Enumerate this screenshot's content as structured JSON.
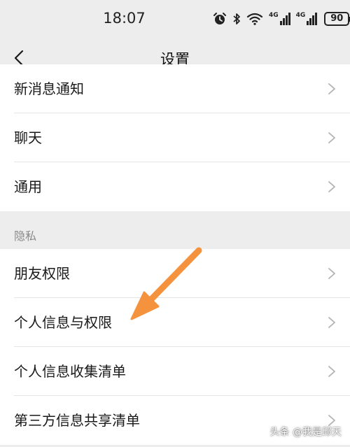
{
  "status_bar": {
    "time": "18:07",
    "icons": [
      "alarm-icon",
      "bluetooth-icon",
      "wifi-icon",
      "signal-4g-icon",
      "signal-4g-icon"
    ],
    "signal_label_1": "4G",
    "signal_label_2": "4G",
    "battery": "90"
  },
  "nav": {
    "title": "设置",
    "back_icon": "chevron-left-icon"
  },
  "groups": [
    {
      "items": [
        {
          "label": "新消息通知"
        },
        {
          "label": "聊天"
        },
        {
          "label": "通用"
        }
      ]
    },
    {
      "header": "隐私",
      "items": [
        {
          "label": "朋友权限"
        },
        {
          "label": "个人信息与权限"
        },
        {
          "label": "个人信息收集清单"
        },
        {
          "label": "第三方信息共享清单"
        }
      ]
    }
  ],
  "annotation": {
    "arrow_color": "#f5923e",
    "points_to": "个人信息与权限"
  },
  "watermark": {
    "text": "头条 @我是邱天"
  },
  "colors": {
    "background": "#ededed",
    "list_bg": "#ffffff",
    "text": "#191919",
    "secondary_text": "#8a8a8a",
    "divider": "#e5e5e5"
  }
}
